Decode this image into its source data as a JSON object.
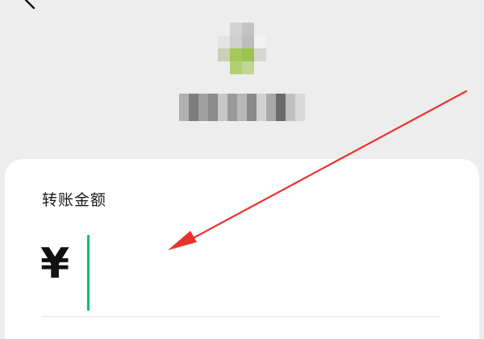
{
  "header": {
    "back_icon": "chevron-left-icon"
  },
  "payee": {
    "avatar_colors": [
      [
        "#ededed",
        "#d3d3d3",
        "#c4c4c4",
        "#ededed"
      ],
      [
        "#e4e4e4",
        "#cfcfcf",
        "#bdbdbd",
        "#f2f2f2"
      ],
      [
        "#c9cfb8",
        "#a6c95a",
        "#9ec24f",
        "#d6d8d0"
      ],
      [
        "#ededed",
        "#b2cf74",
        "#c0d690",
        "#ededed"
      ]
    ],
    "name_colors": [
      "#b0b0b0",
      "#7d7d7d",
      "#a0a0a0",
      "#8c8c8c",
      "#c8c8c8",
      "#9a9a9a",
      "#b8b8b8",
      "#8a8a8a",
      "#d2d2d2",
      "#a8a8a8",
      "#6a6a6a",
      "#c0c0c0",
      "#d8d8d8"
    ]
  },
  "amount": {
    "label": "转账金额",
    "currency_symbol": "¥",
    "value": ""
  },
  "colors": {
    "background": "#ededed",
    "card": "#ffffff",
    "caret": "#07c160",
    "annotation_arrow": "#e8332e"
  }
}
